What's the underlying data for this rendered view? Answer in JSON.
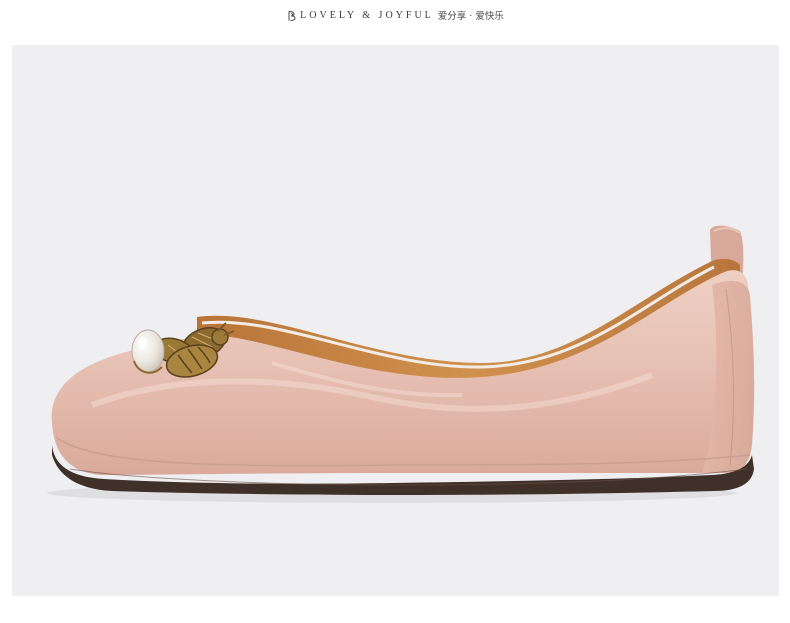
{
  "header": {
    "logo_icon": "b-monogram-icon",
    "brand_en": "LOVELY & JOYFUL",
    "brand_cn": "爱分享 · 爱快乐"
  },
  "product": {
    "image_icon": "pink-leather-flat-shoe-image",
    "colors": {
      "background": "#efeef0",
      "leather": "#e6c0b4",
      "lining": "#c98a4e",
      "sole": "#3f302a",
      "buckle": "#9c7b38",
      "pearl": "#f2efe9"
    }
  }
}
